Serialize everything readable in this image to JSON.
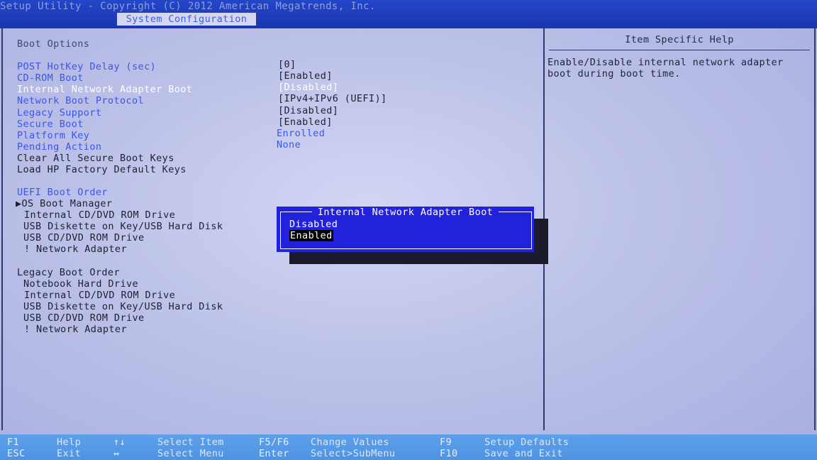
{
  "header": {
    "copyright": "Setup Utility - Copyright (C) 2012 American Megatrends, Inc.",
    "active_tab": "System Configuration"
  },
  "main": {
    "section_title": "Boot Options",
    "settings": [
      {
        "label": "POST HotKey Delay (sec)",
        "value": "[0]"
      },
      {
        "label": "CD-ROM Boot",
        "value": "[Enabled]"
      },
      {
        "label": "Internal Network Adapter Boot",
        "value": "[Disabled]"
      },
      {
        "label": "Network Boot Protocol",
        "value": "[IPv4+IPv6 (UEFI)]"
      },
      {
        "label": "Legacy Support",
        "value": "[Disabled]"
      },
      {
        "label": "Secure Boot",
        "value": "[Enabled]"
      },
      {
        "label": "Platform Key",
        "value": "Enrolled"
      },
      {
        "label": "Pending Action",
        "value": "None"
      },
      {
        "label": "Clear All Secure Boot Keys"
      },
      {
        "label": "Load HP Factory Default Keys"
      }
    ],
    "uefi_boot_order": {
      "title": "UEFI Boot Order",
      "items": [
        "▶OS Boot Manager",
        "Internal CD/DVD ROM Drive",
        "USB Diskette on Key/USB Hard Disk",
        "USB CD/DVD ROM Drive",
        "! Network Adapter"
      ]
    },
    "legacy_boot_order": {
      "title": "Legacy Boot Order",
      "items": [
        "Notebook Hard Drive",
        "Internal CD/DVD ROM Drive",
        "USB Diskette on Key/USB Hard Disk",
        "USB CD/DVD ROM Drive",
        "! Network Adapter"
      ]
    }
  },
  "help": {
    "title": "Item Specific Help",
    "text": "Enable/Disable internal network adapter\nboot during boot time."
  },
  "popup": {
    "title": "Internal Network Adapter Boot",
    "options": [
      "Disabled",
      "Enabled"
    ],
    "selected_index": 1
  },
  "footer": {
    "keys": [
      {
        "key": "F1",
        "action": "Help"
      },
      {
        "key": "ESC",
        "action": "Exit"
      },
      {
        "key": "↑↓",
        "action": "Select Item"
      },
      {
        "key": "↔",
        "action": "Select Menu"
      },
      {
        "key": "F5/F6",
        "action": "Change Values"
      },
      {
        "key": "Enter",
        "action": "Select>SubMenu"
      },
      {
        "key": "F9",
        "action": "Setup Defaults"
      },
      {
        "key": "F10",
        "action": "Save and Exit"
      }
    ]
  },
  "colors": {
    "header_bg": "#1a36b0",
    "popup_bg": "#2222dc",
    "link_blue": "#3a56e8",
    "footer_bg": "#4e93e4"
  }
}
